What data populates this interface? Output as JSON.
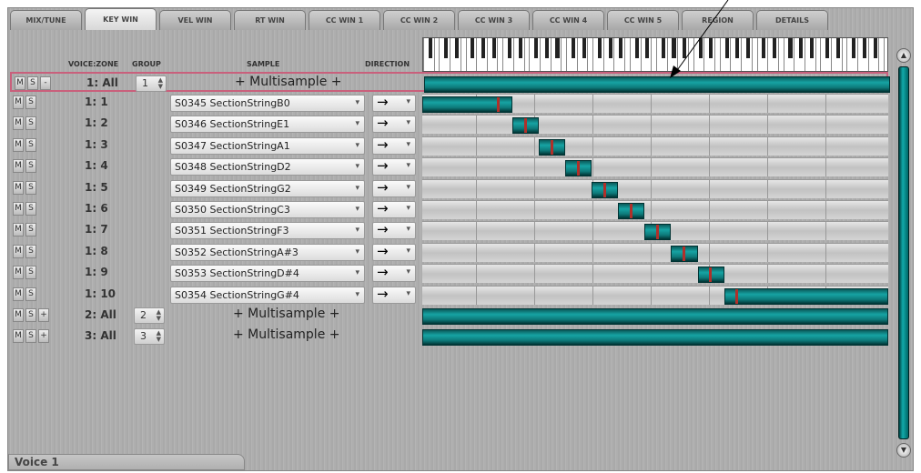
{
  "tabs": [
    "MIX/TUNE",
    "KEY WIN",
    "VEL WIN",
    "RT WIN",
    "CC WIN 1",
    "CC WIN 2",
    "CC WIN 3",
    "CC WIN 4",
    "CC WIN 5",
    "REGION",
    "DETAILS"
  ],
  "active_tab": "KEY WIN",
  "headers": {
    "voice_zone": "VOICE:ZONE",
    "group": "GROUP",
    "sample": "SAMPLE",
    "direction": "DIRECTION"
  },
  "mute_label": "M",
  "solo_label": "S",
  "collapse_label": "-",
  "expand_label": "+",
  "multisample_label": "+ Multisample +",
  "direction_symbol": "→",
  "dropdown_symbol": "▾",
  "voices": [
    {
      "label": "1: All",
      "group": "1",
      "selected": true,
      "expanded": true
    },
    {
      "label": "2: All",
      "group": "2",
      "selected": false,
      "expanded": false
    },
    {
      "label": "3: All",
      "group": "3",
      "selected": false,
      "expanded": false
    }
  ],
  "zones": [
    {
      "label": "1: 1",
      "sample": "S0345 SectionStringB0",
      "lo": 9,
      "hi": 25,
      "root": 23
    },
    {
      "label": "1: 2",
      "sample": "S0346 SectionStringE1",
      "lo": 26,
      "hi": 30,
      "root": 28
    },
    {
      "label": "1: 3",
      "sample": "S0347 SectionStringA1",
      "lo": 31,
      "hi": 35,
      "root": 33
    },
    {
      "label": "1: 4",
      "sample": "S0348 SectionStringD2",
      "lo": 36,
      "hi": 40,
      "root": 38
    },
    {
      "label": "1: 5",
      "sample": "S0349 SectionStringG2",
      "lo": 41,
      "hi": 45,
      "root": 43
    },
    {
      "label": "1: 6",
      "sample": "S0350 SectionStringC3",
      "lo": 46,
      "hi": 50,
      "root": 48
    },
    {
      "label": "1: 7",
      "sample": "S0351 SectionStringF3",
      "lo": 51,
      "hi": 55,
      "root": 53
    },
    {
      "label": "1: 8",
      "sample": "S0352 SectionStringA#3",
      "lo": 56,
      "hi": 60,
      "root": 58
    },
    {
      "label": "1: 9",
      "sample": "S0353 SectionStringD#4",
      "lo": 61,
      "hi": 65,
      "root": 63
    },
    {
      "label": "1: 10",
      "sample": "S0354 SectionStringG#4",
      "lo": 66,
      "hi": 96,
      "root": 68
    }
  ],
  "keyboard_range": [
    9,
    96
  ],
  "footer_tab": "Voice 1",
  "colors": {
    "bar": "#16a3a3",
    "root": "#b0302a",
    "selection": "#c9607c"
  }
}
